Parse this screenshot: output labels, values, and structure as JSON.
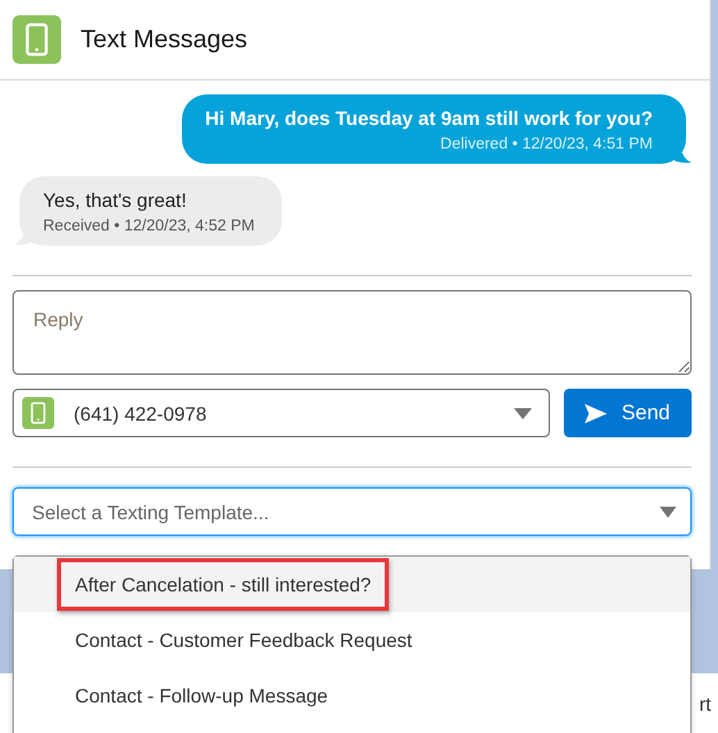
{
  "header": {
    "title": "Text Messages"
  },
  "messages": [
    {
      "kind": "outgoing",
      "text": "Hi Mary, does Tuesday at 9am still work for you?",
      "meta": "Delivered • 12/20/23, 4:51 PM"
    },
    {
      "kind": "incoming",
      "text": "Yes, that's great!",
      "meta": "Received • 12/20/23, 4:52 PM"
    }
  ],
  "reply": {
    "placeholder": "Reply"
  },
  "phone_select": {
    "value": "(641) 422-0978"
  },
  "send_button": {
    "label": "Send"
  },
  "template_select": {
    "placeholder": "Select a Texting Template..."
  },
  "template_options": [
    {
      "label": "After Cancelation - still interested?",
      "selected": true,
      "annotated": true
    },
    {
      "label": "Contact - Customer Feedback Request",
      "selected": false,
      "annotated": false
    },
    {
      "label": "Contact - Follow-up Message",
      "selected": false,
      "annotated": false
    }
  ],
  "background_text": "rt"
}
